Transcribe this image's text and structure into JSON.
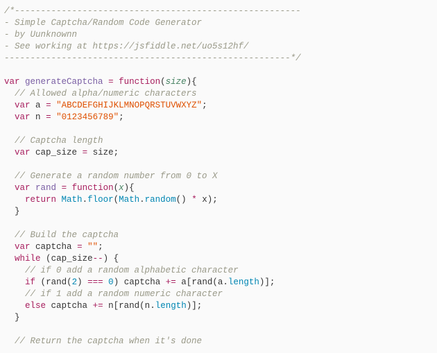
{
  "lines": {
    "c1": "/*-------------------------------------------------------",
    "c2": "- Simple Captcha/Random Code Generator",
    "c3": "- by Uunknownn",
    "c4": "- See working at https://jsfiddle.net/uo5s12hf/",
    "c5": "-------------------------------------------------------*/",
    "kw_var": "var",
    "kw_function": "function",
    "kw_return": "return",
    "kw_while": "while",
    "kw_if": "if",
    "kw_else": "else",
    "fn_generateCaptcha": "generateCaptcha",
    "param_size": "size",
    "cmt_allowed": "// Allowed alpha/numeric characters",
    "id_a": "a",
    "str_alpha": "\"ABCDEFGHIJKLMNOPQRSTUVWXYZ\"",
    "id_n": "n",
    "str_num": "\"0123456789\"",
    "cmt_caplen": "// Captcha length",
    "id_cap_size": "cap_size",
    "id_size": "size",
    "cmt_genrand": "// Generate a random number from 0 to X",
    "id_rand": "rand",
    "param_x": "x",
    "obj_Math": "Math",
    "prop_floor": "floor",
    "prop_random": "random",
    "id_x": "x",
    "cmt_build": "// Build the captcha",
    "id_captcha": "captcha",
    "str_empty": "\"\"",
    "op_decdec": "--",
    "cmt_if0": "// if 0 add a random alphabetic character",
    "num_2": "2",
    "op_eqeqeq": "===",
    "num_0": "0",
    "op_pluseq": "+=",
    "prop_length": "length",
    "cmt_if1": "// if 1 add a random numeric character",
    "cmt_return": "// Return the captcha when it's done",
    "op_eq": "=",
    "op_star": "*",
    "p_open": "(",
    "p_close": ")",
    "p_obrace": "{",
    "p_cbrace": "}",
    "p_obrack": "[",
    "p_cbrack": "]",
    "p_semi": ";",
    "p_dot": "."
  }
}
